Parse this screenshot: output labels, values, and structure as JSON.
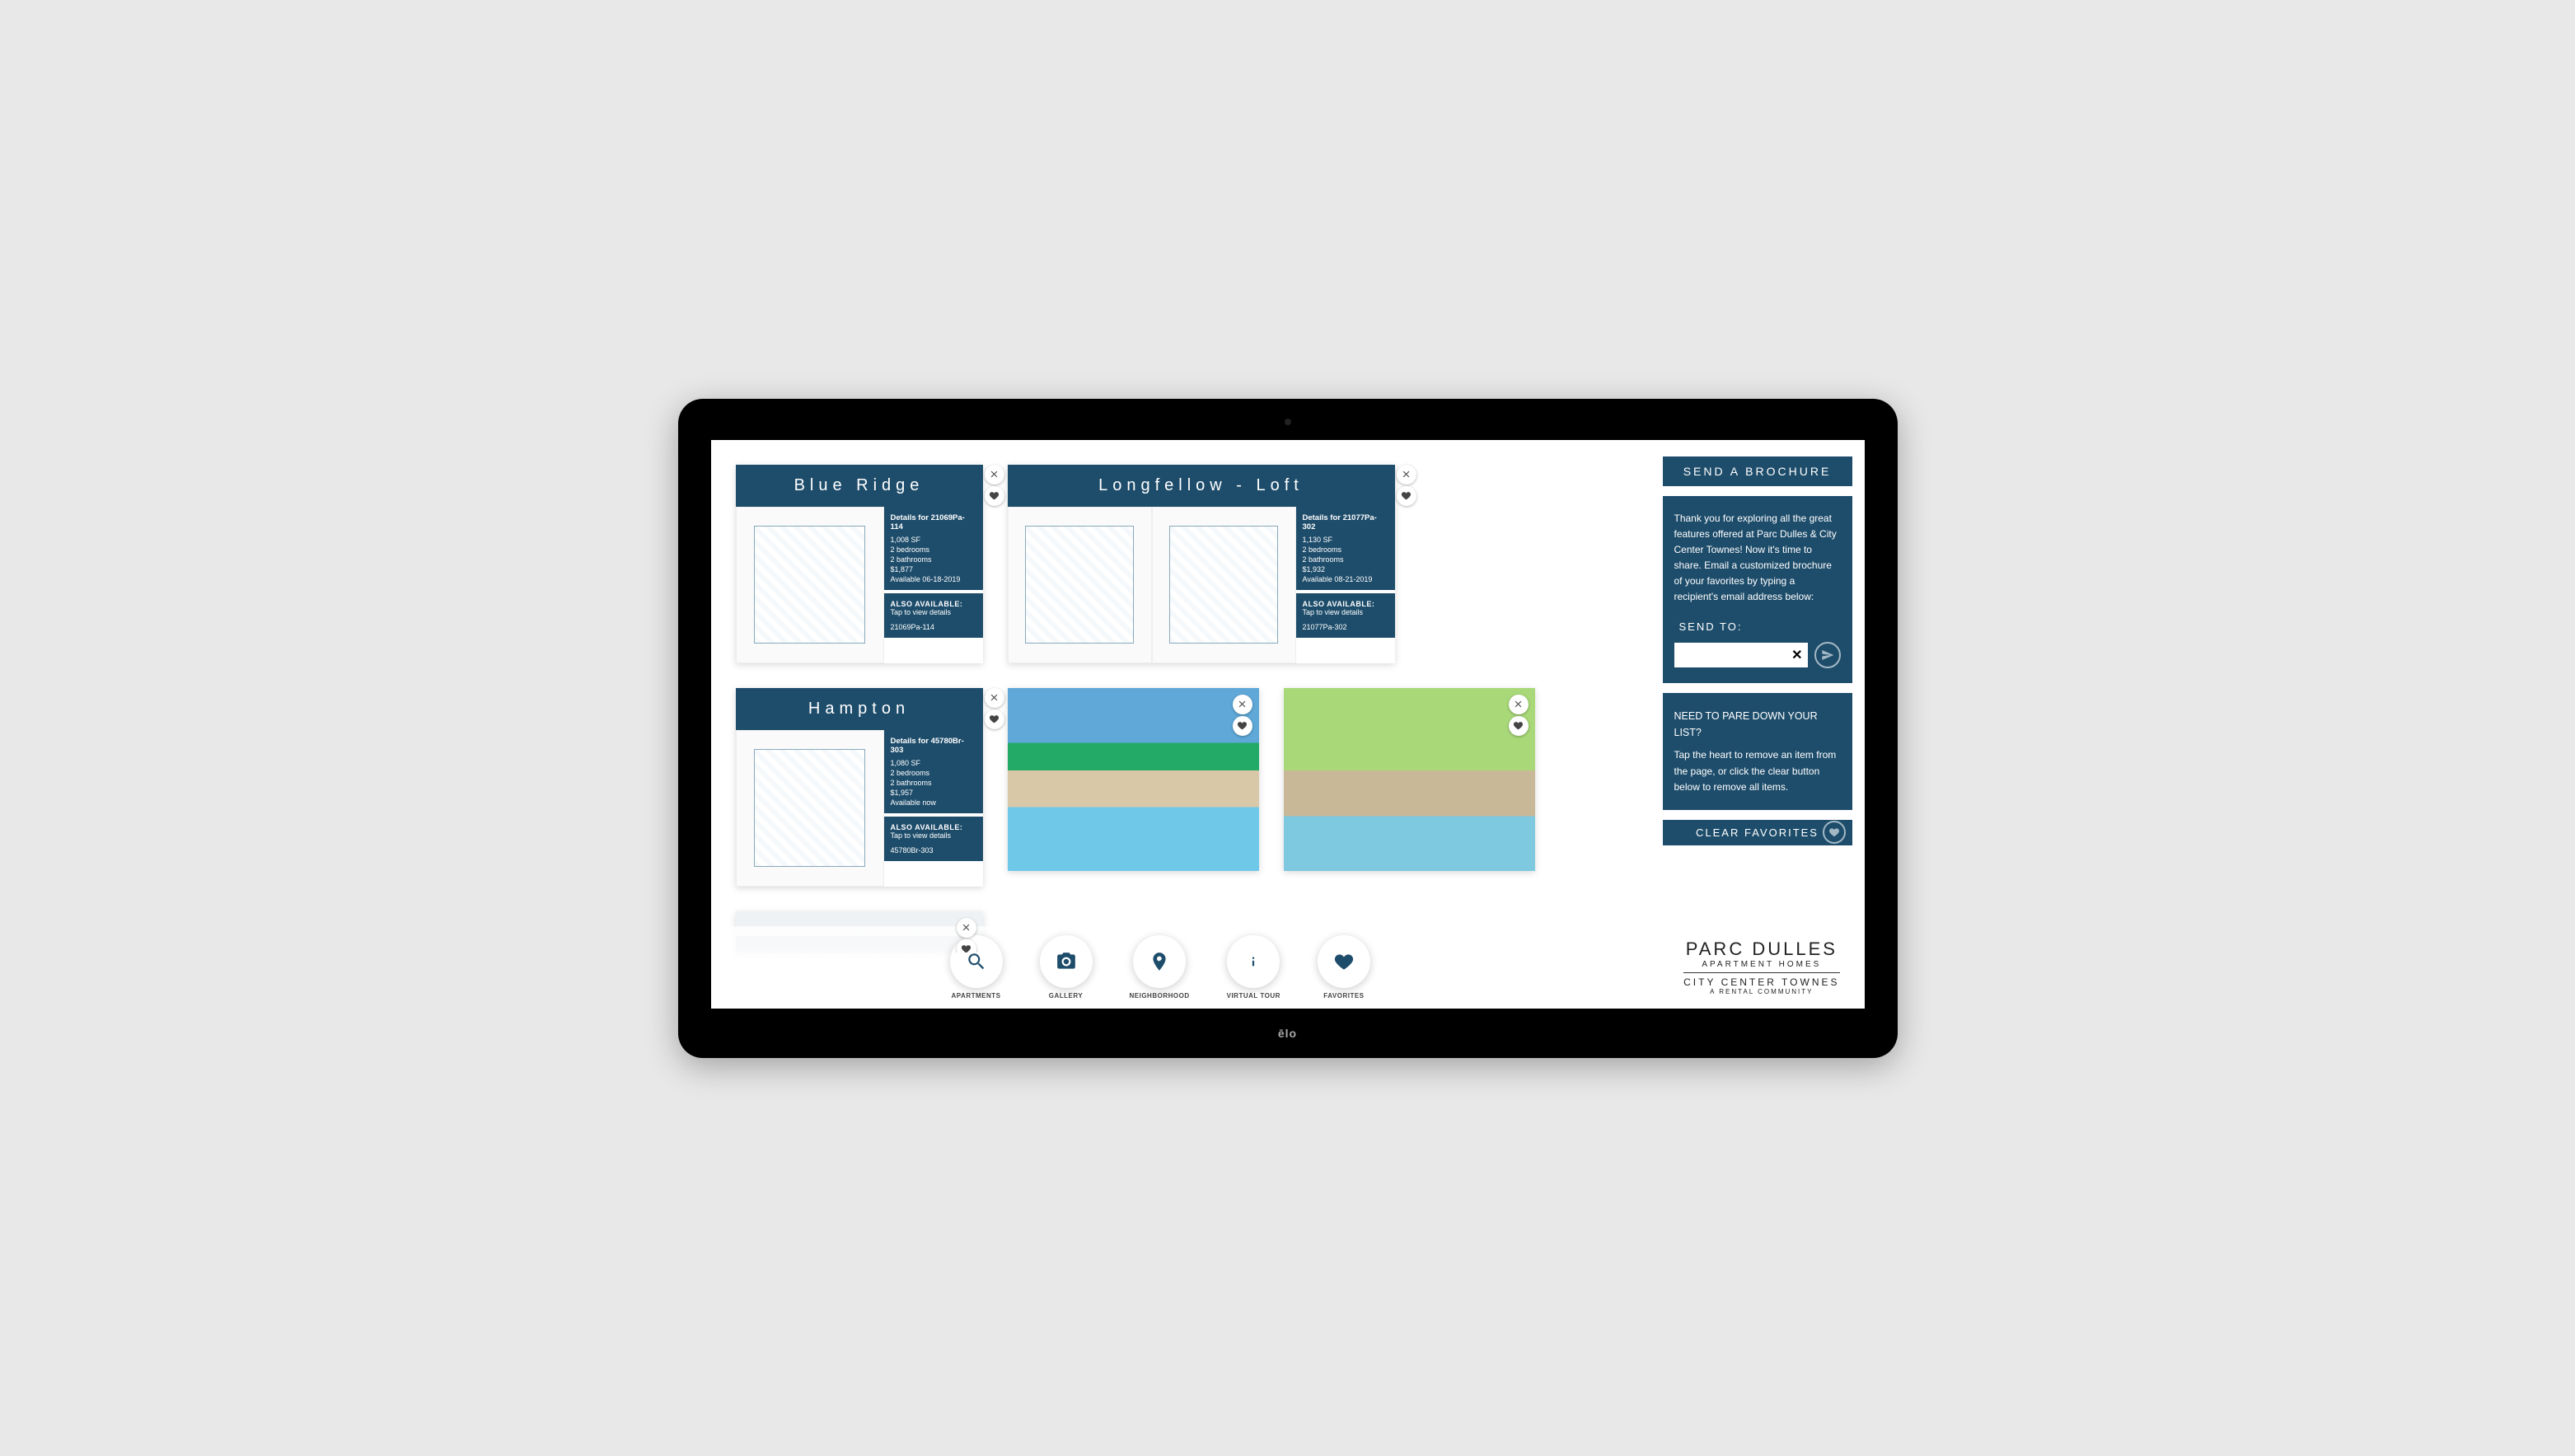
{
  "device_brand": "ēlo",
  "cards": {
    "blue_ridge": {
      "title": "Blue Ridge",
      "details_title": "Details for 21069Pa-114",
      "sf": "1,008 SF",
      "beds": "2 bedrooms",
      "baths": "2 bathrooms",
      "price": "$1,877",
      "avail": "Available 06-18-2019",
      "also_title": "ALSO AVAILABLE:",
      "also_sub": "Tap to view details",
      "also_unit": "21069Pa-114"
    },
    "longfellow": {
      "title": "Longfellow - Loft",
      "details_title": "Details for 21077Pa-302",
      "sf": "1,130 SF",
      "beds": "2 bedrooms",
      "baths": "2 bathrooms",
      "price": "$1,932",
      "avail": "Available 08-21-2019",
      "also_title": "ALSO AVAILABLE:",
      "also_sub": "Tap to view details",
      "also_unit": "21077Pa-302"
    },
    "hampton": {
      "title": "Hampton",
      "details_title": "Details for 45780Br-303",
      "sf": "1,080 SF",
      "beds": "2 bedrooms",
      "baths": "2 bathrooms",
      "price": "$1,957",
      "avail": "Available now",
      "also_title": "ALSO AVAILABLE:",
      "also_sub": "Tap to view details",
      "also_unit": "45780Br-303"
    }
  },
  "sidebar": {
    "header": "SEND A BROCHURE",
    "intro": "Thank you for exploring all the great features offered at Parc Dulles & City Center Townes! Now it's time to share. Email a customized brochure of your favorites by typing a recipient's email address below:",
    "send_to": "SEND TO:",
    "input_clear": "✕",
    "pare_title": "NEED TO PARE DOWN YOUR LIST?",
    "pare_text": "Tap the heart to remove an item from the page, or click the clear button below to remove all items.",
    "clear": "CLEAR FAVORITES"
  },
  "nav": {
    "apartments": "APARTMENTS",
    "gallery": "GALLERY",
    "neighborhood": "NEIGHBORHOOD",
    "virtual_tour": "VIRTUAL TOUR",
    "favorites": "FAVORITES"
  },
  "logo": {
    "l1": "PARC DULLES",
    "l2": "APARTMENT HOMES",
    "l3": "CITY CENTER TOWNES",
    "l4": "A RENTAL COMMUNITY"
  }
}
